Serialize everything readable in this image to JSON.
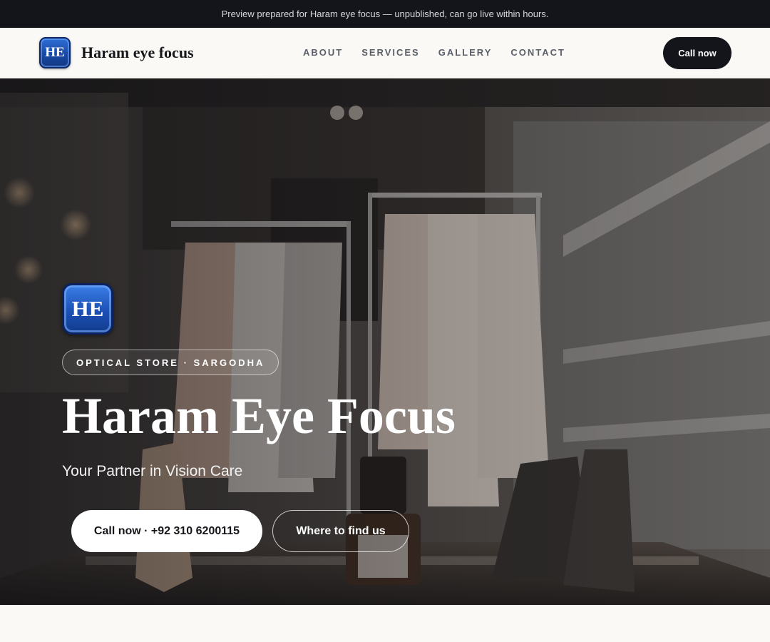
{
  "banner": {
    "text": "Preview prepared for Haram eye focus — unpublished, can go live within hours."
  },
  "header": {
    "logo_text": "HE",
    "brand_name": "Haram eye focus",
    "nav": [
      {
        "label": "ABOUT"
      },
      {
        "label": "SERVICES"
      },
      {
        "label": "GALLERY"
      },
      {
        "label": "CONTACT"
      }
    ],
    "cta_label": "Call now"
  },
  "hero": {
    "logo_text": "HE",
    "tag": "OPTICAL STORE · SARGODHA",
    "title": "Haram Eye Focus",
    "subtitle": "Your Partner in Vision Care",
    "primary_button": "Call now · +92 310 6200115",
    "secondary_button": "Where to find us",
    "background_image": "boutique-store-interior-photo"
  },
  "colors": {
    "dark": "#13151a",
    "logo_blue": "#1c51b5",
    "page_bg": "#faf9f6",
    "nav_text": "#5a5f69"
  }
}
